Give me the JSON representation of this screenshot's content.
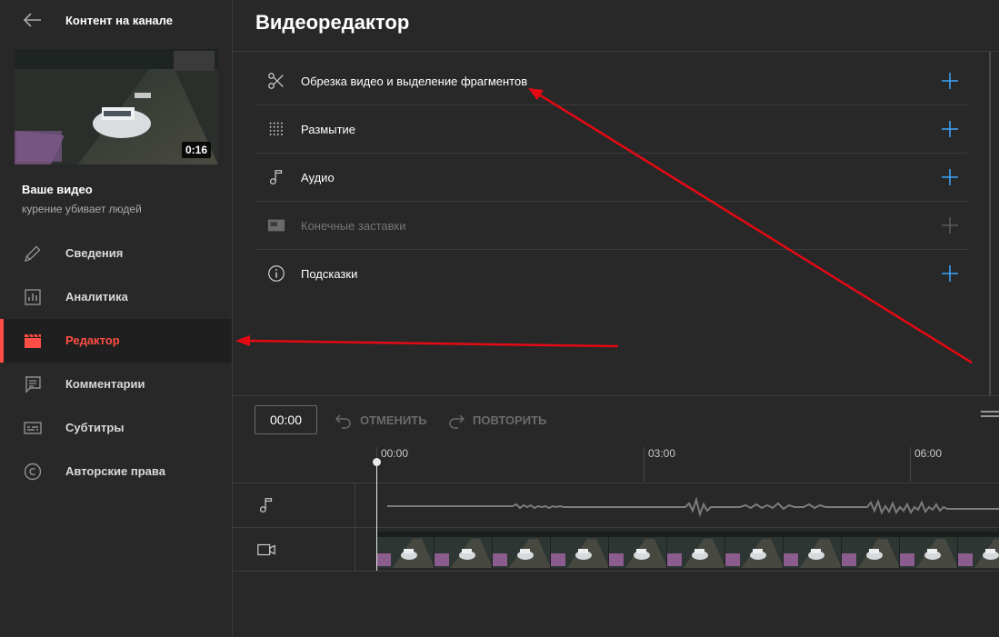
{
  "sidebar": {
    "back_icon": "arrow-left-icon",
    "title": "Контент на канале",
    "thumbnail": {
      "duration": "0:16"
    },
    "your_video_label": "Ваше видео",
    "video_title": "курение убивает людей",
    "items": [
      {
        "label": "Сведения",
        "icon": "pencil-icon",
        "active": false
      },
      {
        "label": "Аналитика",
        "icon": "analytics-icon",
        "active": false
      },
      {
        "label": "Редактор",
        "icon": "clapperboard-icon",
        "active": true
      },
      {
        "label": "Комментарии",
        "icon": "comment-icon",
        "active": false
      },
      {
        "label": "Субтитры",
        "icon": "subtitles-icon",
        "active": false
      },
      {
        "label": "Авторские права",
        "icon": "copyright-icon",
        "active": false
      }
    ]
  },
  "main": {
    "title": "Видеоредактор",
    "tools": [
      {
        "label": "Обрезка видео и выделение фрагментов",
        "icon": "scissors-icon",
        "enabled": true
      },
      {
        "label": "Размытие",
        "icon": "blur-icon",
        "enabled": true
      },
      {
        "label": "Аудио",
        "icon": "music-note-icon",
        "enabled": true
      },
      {
        "label": "Конечные заставки",
        "icon": "end-screen-icon",
        "enabled": false
      },
      {
        "label": "Подсказки",
        "icon": "info-icon",
        "enabled": true
      }
    ]
  },
  "timeline": {
    "current_time": "00:00",
    "undo_label": "ОТМЕНИТЬ",
    "redo_label": "ПОВТОРИТЬ",
    "ticks": [
      "00:00",
      "03:00",
      "06:00"
    ]
  },
  "colors": {
    "background": "#282828",
    "accent_red": "#ff4e45",
    "plus_blue": "#3ea6ff",
    "annotation_arrow": "#e50914"
  }
}
